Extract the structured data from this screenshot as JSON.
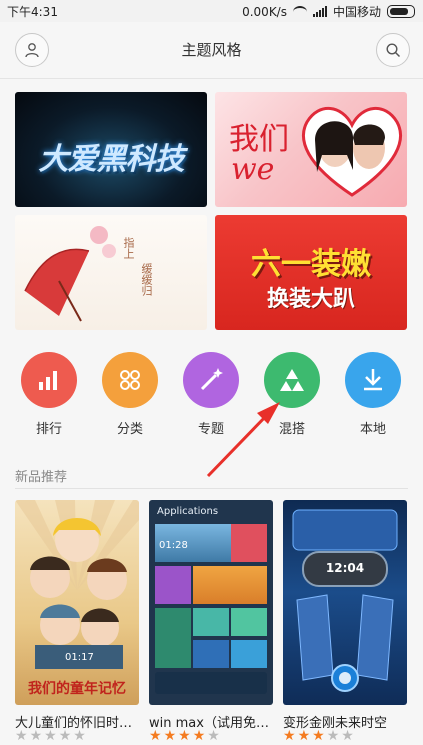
{
  "status": {
    "time": "下午4:31",
    "speed": "0.00K/s",
    "carrier": "中国移动"
  },
  "header": {
    "title": "主题风格"
  },
  "banners": [
    {
      "text": "大爱黑科技"
    },
    {
      "text_cn": "我们",
      "text_en": "we"
    },
    {
      "text_a": "指上",
      "text_b": "缓缓归"
    },
    {
      "text_a": "六一装嫩",
      "text_b": "换装大趴"
    }
  ],
  "categories": [
    {
      "label": "排行",
      "color": "#ee5b4f",
      "icon": "bar-chart-icon"
    },
    {
      "label": "分类",
      "color": "#f4a03c",
      "icon": "grid-icon"
    },
    {
      "label": "专题",
      "color": "#b065e0",
      "icon": "magic-wand-icon"
    },
    {
      "label": "混搭",
      "color": "#3dba6f",
      "icon": "triangles-icon"
    },
    {
      "label": "本地",
      "color": "#39a5ec",
      "icon": "download-icon"
    }
  ],
  "section_title": "新品推荐",
  "themes": [
    {
      "name": "大儿童们的怀旧时…",
      "rating": 0,
      "cover_text": "我们的童年记忆",
      "cover_time": "01:17"
    },
    {
      "name": "win max（试用免…",
      "rating": 4,
      "cover_header": "Applications",
      "cover_time": "01:28"
    },
    {
      "name": "变形金刚未来时空",
      "rating": 3,
      "cover_time": "12:04"
    }
  ]
}
